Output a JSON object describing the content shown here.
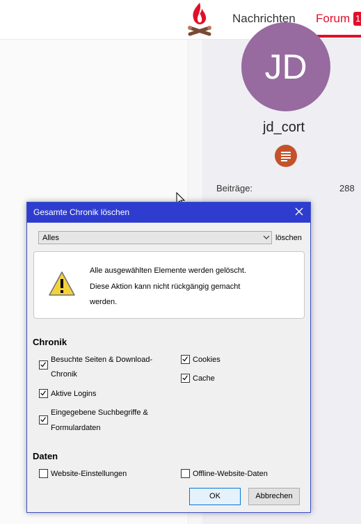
{
  "nav": {
    "news_label": "Nachrichten",
    "forum_label": "Forum",
    "forum_badge": "1",
    "accent_color": "#e0102a"
  },
  "profile": {
    "avatar_initials": "JD",
    "avatar_color": "#976aa0",
    "username": "jd_cort",
    "rank_icon": "rank-badge-icon",
    "stats": [
      {
        "label": "Beiträge:",
        "value": "288"
      }
    ]
  },
  "dialog": {
    "title": "Gesamte Chronik löschen",
    "close_icon": "close-icon",
    "time_range": "Alles",
    "time_range_suffix": "löschen",
    "warning_lines": [
      "Alle ausgewählten Elemente werden gelöscht.",
      "Diese Aktion kann nicht rückgängig gemacht",
      "werden."
    ],
    "history_heading": "Chronik",
    "history_items": [
      {
        "label_lines": [
          "Besuchte Seiten & Download-",
          "Chronik"
        ],
        "checked": true
      },
      {
        "label_lines": [
          "Aktive Logins"
        ],
        "checked": true
      },
      {
        "label_lines": [
          "Eingegebene Suchbegriffe &",
          "Formulardaten"
        ],
        "checked": true
      },
      {
        "label_lines": [
          "Cookies"
        ],
        "checked": true
      },
      {
        "label_lines": [
          "Cache"
        ],
        "checked": true
      }
    ],
    "data_heading": "Daten",
    "data_items": [
      {
        "label_lines": [
          "Website-Einstellungen"
        ],
        "checked": false
      },
      {
        "label_lines": [
          "Offline-Website-Daten"
        ],
        "checked": false
      }
    ],
    "ok_label": "OK",
    "cancel_label": "Abbrechen",
    "title_bar_color": "#2e3dcf"
  }
}
